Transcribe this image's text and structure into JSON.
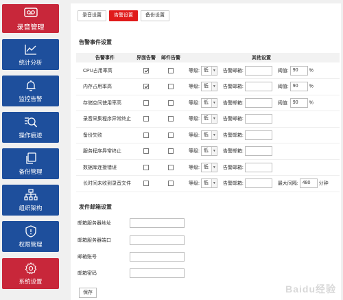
{
  "sidebar": {
    "items": [
      {
        "label": "录音管理",
        "icon": "recorder-icon",
        "active": true
      },
      {
        "label": "统计分析",
        "icon": "line-chart-icon"
      },
      {
        "label": "监控告警",
        "icon": "bell-icon"
      },
      {
        "label": "操作痕迹",
        "icon": "search-doc-icon"
      },
      {
        "label": "备份管理",
        "icon": "copy-icon"
      },
      {
        "label": "组织架构",
        "icon": "org-chart-icon"
      },
      {
        "label": "权限管理",
        "icon": "shield-icon"
      },
      {
        "label": "系统设置",
        "icon": "gear-icon",
        "active": true
      }
    ]
  },
  "tabs": [
    {
      "label": "录音设置"
    },
    {
      "label": "告警设置",
      "active": true
    },
    {
      "label": "备份设置"
    }
  ],
  "alert_section": {
    "title": "告警事件设置",
    "headers": {
      "event": "告警事件",
      "ui": "界面告警",
      "mail": "邮件告警",
      "other": "其他设置"
    },
    "level_label": "等级:",
    "email_label": "告警邮箱:",
    "threshold_label": "阈值:",
    "max_interval_label": "最大间隔:",
    "rows": [
      {
        "event": "CPU占用率高",
        "ui": true,
        "mail": false,
        "level": "低",
        "threshold": "90",
        "unit": "%"
      },
      {
        "event": "内存占用率高",
        "ui": true,
        "mail": false,
        "level": "低",
        "threshold": "90",
        "unit": "%"
      },
      {
        "event": "存储空间使用率高",
        "ui": false,
        "mail": false,
        "level": "低",
        "threshold": "90",
        "unit": "%"
      },
      {
        "event": "录音采集程序异常终止",
        "ui": false,
        "mail": false,
        "level": "低"
      },
      {
        "event": "备份失败",
        "ui": false,
        "mail": false,
        "level": "低"
      },
      {
        "event": "服务程序异常终止",
        "ui": false,
        "mail": false,
        "level": "低"
      },
      {
        "event": "数据库连接错误",
        "ui": false,
        "mail": false,
        "level": "低"
      },
      {
        "event": "长时间未收到录音文件",
        "ui": false,
        "mail": false,
        "level": "低",
        "max_interval": "480",
        "unit": "分钟"
      }
    ]
  },
  "mail_section": {
    "title": "发件邮箱设置",
    "fields": [
      {
        "label": "邮箱服务器地址",
        "value": ""
      },
      {
        "label": "邮箱服务器端口",
        "value": ""
      },
      {
        "label": "邮箱账号",
        "value": ""
      },
      {
        "label": "邮箱密码",
        "value": ""
      }
    ],
    "save_label": "保存"
  },
  "watermark": "Baidu经验"
}
